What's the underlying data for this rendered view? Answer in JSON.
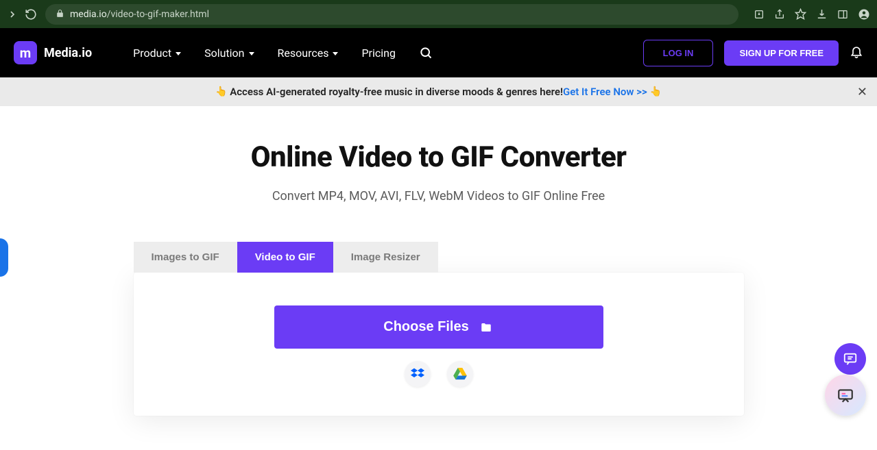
{
  "browser": {
    "url_domain": "media.io",
    "url_path": "/video-to-gif-maker.html"
  },
  "header": {
    "brand": "Media.io",
    "logo_letter": "m",
    "nav": [
      {
        "label": "Product",
        "has_dropdown": true
      },
      {
        "label": "Solution",
        "has_dropdown": true
      },
      {
        "label": "Resources",
        "has_dropdown": true
      },
      {
        "label": "Pricing",
        "has_dropdown": false
      }
    ],
    "login_label": "LOG IN",
    "signup_label": "SIGN UP FOR FREE"
  },
  "promo": {
    "text_before": "Access AI-generated royalty-free music in diverse moods & genres here! ",
    "link_text": "Get It Free Now >>"
  },
  "main": {
    "title": "Online Video to GIF Converter",
    "subtitle": "Convert MP4, MOV, AVI, FLV, WebM Videos to GIF Online Free",
    "tabs": [
      {
        "label": "Images to GIF",
        "active": false
      },
      {
        "label": "Video to GIF",
        "active": true
      },
      {
        "label": "Image Resizer",
        "active": false
      }
    ],
    "choose_label": "Choose Files",
    "cloud_sources": [
      "dropbox",
      "google-drive"
    ]
  },
  "colors": {
    "accent": "#6b3cf5",
    "link": "#1a73e8"
  }
}
